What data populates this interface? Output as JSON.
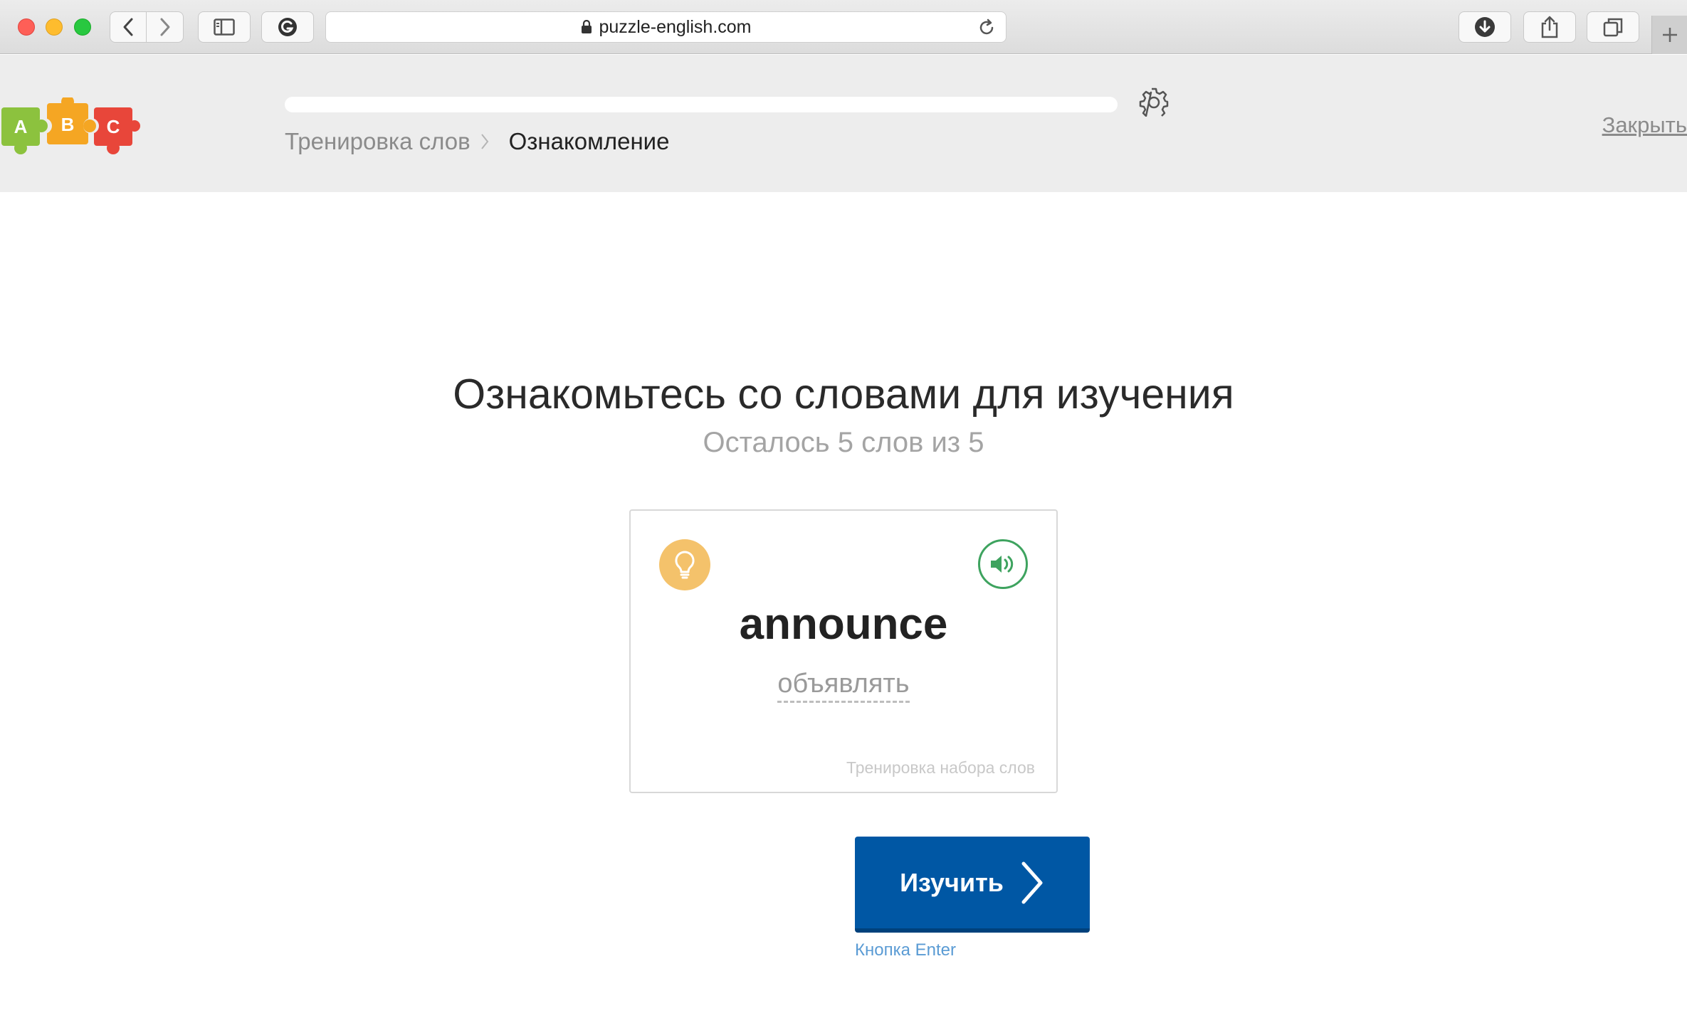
{
  "browser": {
    "url": "puzzle-english.com"
  },
  "header": {
    "logo_letters": [
      "A",
      "B",
      "C"
    ],
    "breadcrumb": {
      "parent": "Тренировка слов",
      "current": "Ознакомление"
    },
    "close_label": "Закрыть",
    "progress": 0
  },
  "main": {
    "title": "Ознакомьтесь со словами для изучения",
    "subtitle": "Осталось 5 слов из 5",
    "card": {
      "word": "announce",
      "translation": "объявлять",
      "footer": "Тренировка набора слов",
      "hint_icon": "lightbulb-icon",
      "sound_icon": "speaker-icon"
    },
    "learn_button": "Изучить",
    "enter_hint": "Кнопка Enter"
  },
  "colors": {
    "accent_blue": "#0057a4",
    "hint_yellow": "#f4c26b",
    "sound_green": "#3ea35f",
    "logo_green": "#8cc23e",
    "logo_orange": "#f5a623",
    "logo_red": "#e8463a"
  }
}
